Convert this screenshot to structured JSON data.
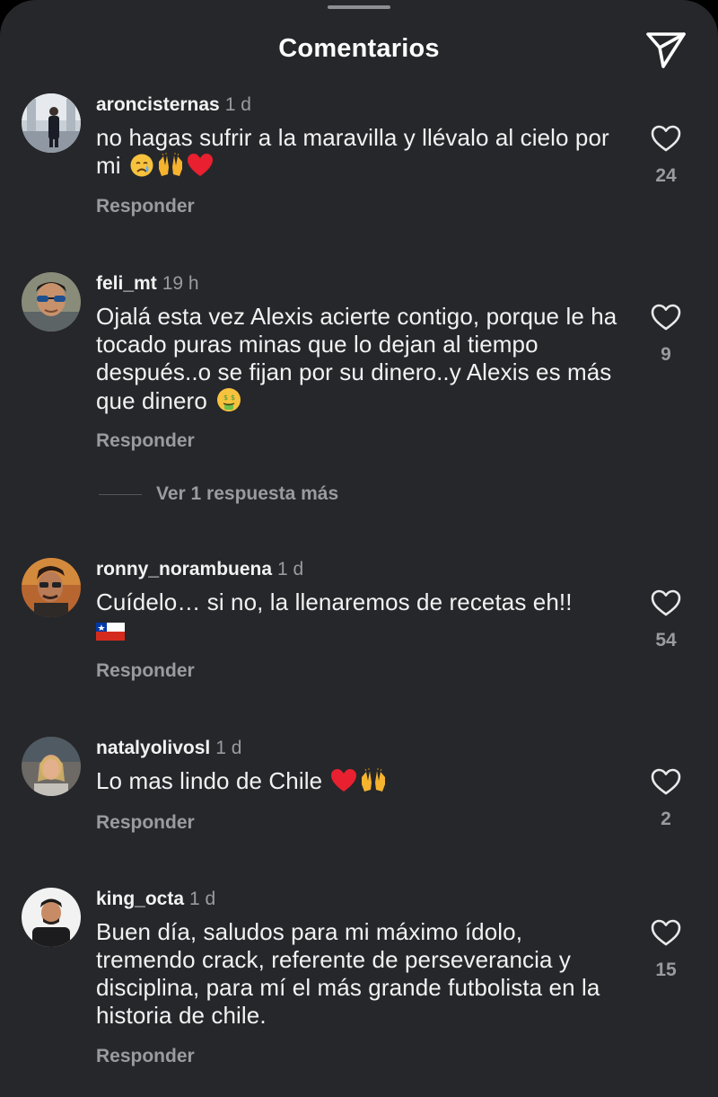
{
  "header": {
    "title": "Comentarios",
    "share_icon": "paper-plane-icon"
  },
  "reply_label": "Responder",
  "view_replies_label": "Ver 1 respuesta más",
  "colors": {
    "background": "#26272b",
    "text": "#f2f2f2",
    "muted": "#9a9b9f",
    "heart_red": "#e0245e"
  },
  "comments": [
    {
      "username": "aroncisternas",
      "time": "1 d",
      "text": "no hagas sufrir a la maravilla y llévalo al cielo por mi",
      "emojis": [
        "crying-face-emoji",
        "raised-hands-emoji",
        "red-heart-emoji"
      ],
      "likes": "24",
      "avatar": "avatar-photo"
    },
    {
      "username": "feli_mt",
      "time": "19 h",
      "text": "Ojalá esta vez Alexis acierte contigo, porque le ha tocado puras minas que lo dejan al tiempo después..o se fijan por su dinero..y Alexis es más que dinero",
      "emojis": [
        "money-mouth-face-emoji"
      ],
      "likes": "9",
      "avatar": "avatar-photo"
    },
    {
      "username": "ronny_norambuena",
      "time": "1 d",
      "text": "Cuídelo… si no, la llenaremos de recetas eh!!",
      "emojis": [
        "chile-flag-emoji"
      ],
      "likes": "54",
      "avatar": "avatar-photo"
    },
    {
      "username": "natalyolivosl",
      "time": "1 d",
      "text": "Lo mas lindo de Chile",
      "emojis": [
        "red-heart-emoji",
        "raised-hands-emoji"
      ],
      "likes": "2",
      "avatar": "avatar-photo"
    },
    {
      "username": "king_octa",
      "time": "1 d",
      "text": "Buen día, saludos para mi máximo ídolo, tremendo crack, referente de perseverancia y disciplina, para mí el más grande futbolista en la historia de chile.",
      "emojis": [],
      "likes": "15",
      "avatar": "avatar-photo"
    }
  ]
}
